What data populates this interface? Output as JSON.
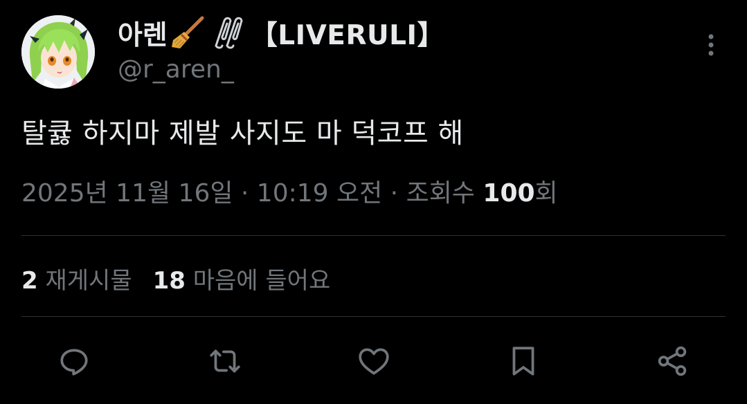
{
  "author": {
    "display_name": "아렌",
    "name_tag": "【LIVERULI】",
    "handle": "@r_aren_",
    "avatar_icon": "anime-avatar"
  },
  "tweet": {
    "text": "탈큟 하지마 제발 사지도 마 덕코프 해"
  },
  "meta": {
    "timestamp": "2025년 11월 16일 · 10:19 오전 · 조회수",
    "views": "100",
    "views_suffix": "회"
  },
  "stats": {
    "retweets": "2",
    "retweets_label": "재게시물",
    "likes": "18",
    "likes_label": "마음에 들어요"
  },
  "actions": [
    "reply-icon",
    "retweet-icon",
    "like-icon",
    "bookmark-icon",
    "share-icon"
  ],
  "colors": {
    "background": "#000000",
    "text_primary": "#e7e9ea",
    "text_secondary": "#71767b",
    "divider": "#2f3336"
  }
}
